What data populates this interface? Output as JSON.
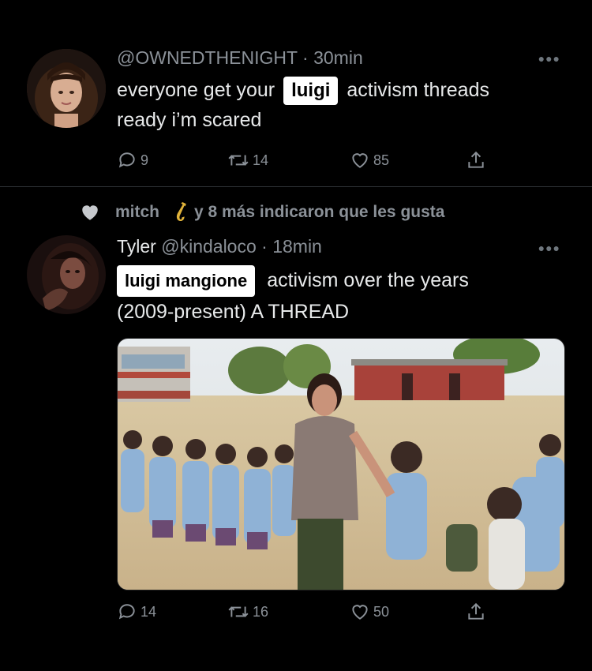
{
  "tweet1": {
    "handle": "@OWNEDTHENIGHT",
    "time": "· 30min",
    "text_before": "everyone get your",
    "sticker": "luigi",
    "text_after": "activism threads",
    "text_line2": "ready i’m scared",
    "replies": "9",
    "retweets": "14",
    "likes": "85"
  },
  "tweet2": {
    "liked_by": "mitch",
    "liked_suffix": "y 8 más indicaron que les gusta",
    "name": "Tyler",
    "handle": "@kindaloco",
    "time": "· 18min",
    "sticker": "luigi mangione",
    "text_after": "activism over the years",
    "text_line2": "(2009-present) A THREAD",
    "replies": "14",
    "retweets": "16",
    "likes": "50"
  },
  "colors": {
    "background": "#000000",
    "text": "#e7e9ea",
    "muted": "#8b9198",
    "sticker_bg": "#ffffff"
  },
  "icons": [
    "reply-icon",
    "retweet-icon",
    "like-icon",
    "share-icon",
    "more-icon",
    "saxophone-icon"
  ]
}
